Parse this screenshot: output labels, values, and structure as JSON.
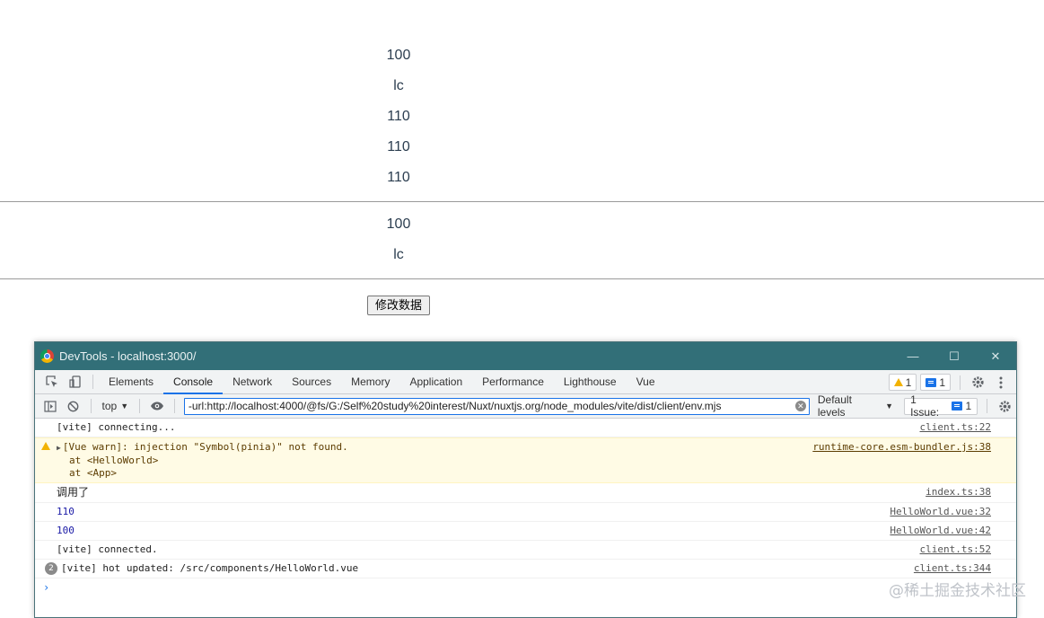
{
  "page": {
    "values_block1": [
      "100",
      "lc",
      "110",
      "110",
      "110"
    ],
    "values_block2": [
      "100",
      "lc"
    ],
    "modify_button_label": "修改数据"
  },
  "devtools": {
    "title": "DevTools - localhost:3000/",
    "window_controls": {
      "minimize": "—",
      "maximize": "☐",
      "close": "✕"
    },
    "tabs": [
      "Elements",
      "Console",
      "Network",
      "Sources",
      "Memory",
      "Application",
      "Performance",
      "Lighthouse",
      "Vue"
    ],
    "active_tab": "Console",
    "warning_count": "1",
    "message_count": "1",
    "console_toolbar": {
      "context": "top",
      "filter_value": "-url:http://localhost:4000/@fs/G:/Self%20study%20interest/Nuxt/nuxtjs.org/node_modules/vite/dist/client/env.mjs",
      "levels": "Default levels",
      "issues_label": "1 Issue:",
      "issues_count": "1"
    },
    "console_rows": [
      {
        "text": "[vite] connecting...",
        "source": "client.ts:22"
      },
      {
        "text": "[Vue warn]: injection \"Symbol(pinia)\" not found.",
        "line2": "at <HelloWorld>",
        "line3": "at <App>",
        "source": "runtime-core.esm-bundler.js:38"
      },
      {
        "text": "调用了",
        "source": "index.ts:38"
      },
      {
        "text": "110",
        "source": "HelloWorld.vue:32"
      },
      {
        "text": "100",
        "source": "HelloWorld.vue:42"
      },
      {
        "text": "[vite] connected.",
        "source": "client.ts:52"
      },
      {
        "count": "2",
        "text": "[vite] hot updated: /src/components/HelloWorld.vue",
        "source": "client.ts:344"
      }
    ],
    "prompt": "›"
  },
  "watermark": "@稀土掘金技术社区"
}
